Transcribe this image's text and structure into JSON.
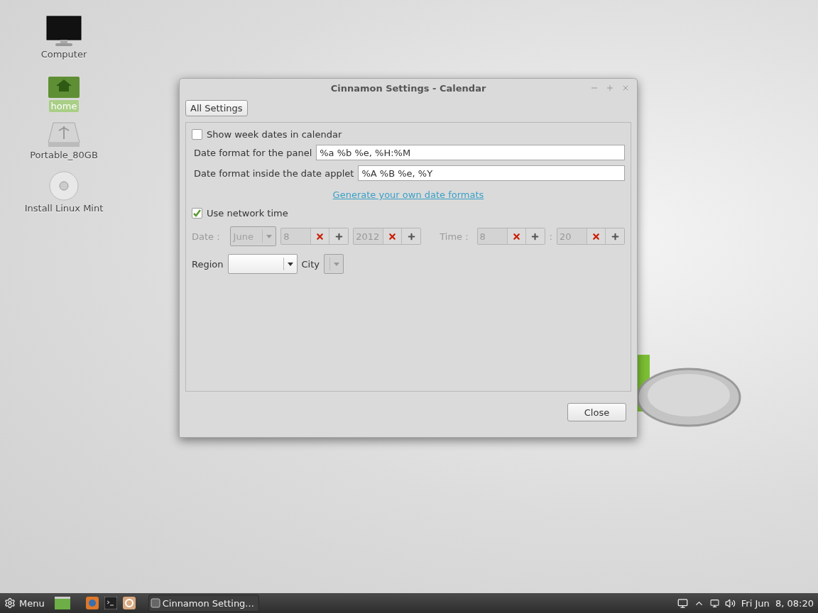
{
  "desktop_icons": [
    {
      "kind": "computer",
      "label": "Computer",
      "selected": false
    },
    {
      "kind": "home",
      "label": "home",
      "selected": true
    },
    {
      "kind": "drive",
      "label": "Portable_80GB",
      "selected": false
    },
    {
      "kind": "disc",
      "label": "Install Linux Mint",
      "selected": false
    }
  ],
  "window": {
    "title": "Cinnamon Settings - Calendar",
    "all_settings_button": "All Settings",
    "show_week_dates": {
      "label": "Show week dates in calendar",
      "checked": false
    },
    "panel_format": {
      "label": "Date format for the panel",
      "value": "%a %b %e, %H:%M"
    },
    "applet_format": {
      "label": "Date format inside the date applet",
      "value": "%A %B %e, %Y"
    },
    "link": "Generate your own date formats",
    "network_time": {
      "label": "Use network time",
      "checked": true
    },
    "date_time": {
      "disabled": true,
      "date_label": "Date :",
      "month": "June",
      "day": "8",
      "year": "2012",
      "time_label": "Time :",
      "hour": "8",
      "separator": ":",
      "minute": "20"
    },
    "region": {
      "label": "Region"
    },
    "city": {
      "label": "City"
    },
    "close_button": "Close"
  },
  "taskbar": {
    "menu": "Menu",
    "launchers": [
      {
        "kind": "browser"
      },
      {
        "kind": "terminal"
      },
      {
        "kind": "app"
      }
    ],
    "window_button": "Cinnamon Setting...",
    "clock": "Fri Jun  8, 08:20"
  }
}
